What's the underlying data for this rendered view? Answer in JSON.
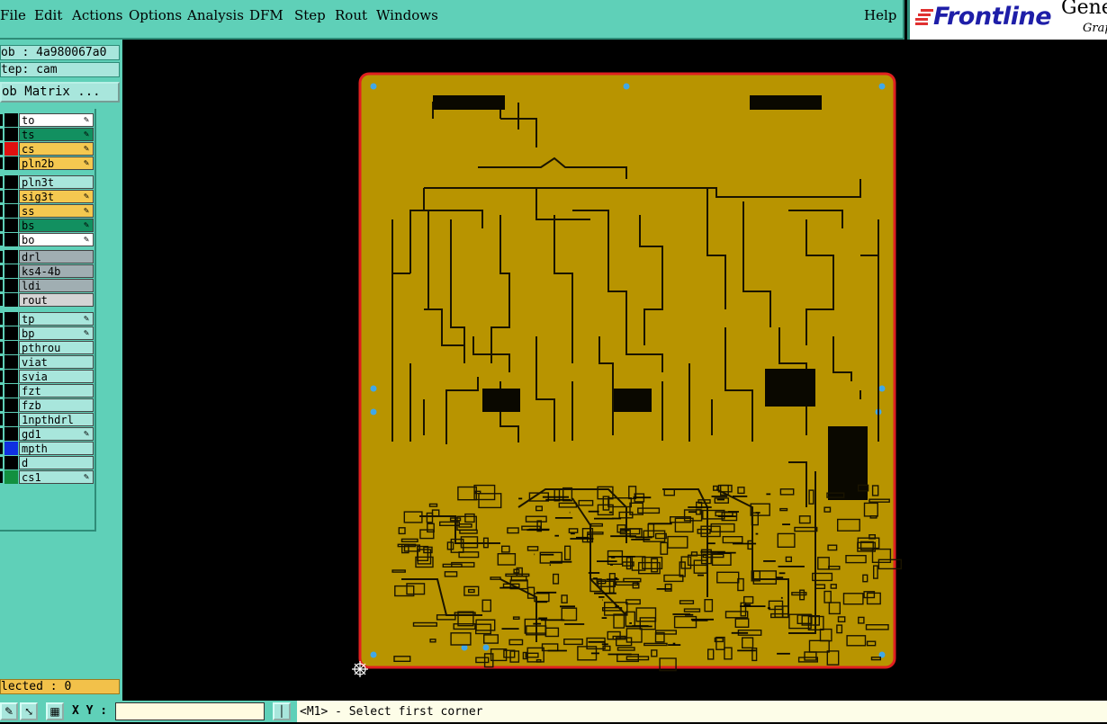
{
  "menu": {
    "file": "File",
    "edit": "Edit",
    "actions": "Actions",
    "options": "Options",
    "analysis": "Analysis",
    "dfm": "DFM",
    "step": "Step",
    "rout": "Rout",
    "windows": "Windows",
    "help": "Help"
  },
  "logo": {
    "brand": "Frontline",
    "product": "Gene",
    "sub": "Grap"
  },
  "panel": {
    "job": "ob : 4a980067a0",
    "step": "tep: cam",
    "matrix_button": "ob Matrix ...",
    "selected": "lected : 0"
  },
  "layers": [
    {
      "name": "to",
      "bg": "#ffffff",
      "swatch": "#000000",
      "pen": true
    },
    {
      "name": "ts",
      "bg": "#129060",
      "swatch": "#000000",
      "pen": true
    },
    {
      "name": "cs",
      "bg": "#f5c850",
      "swatch": "#e01010",
      "pen": true
    },
    {
      "name": "pln2b",
      "bg": "#f5c850",
      "swatch": "#000000",
      "pen": true
    },
    {
      "name": "pln3t",
      "bg": "#a8e6dc",
      "swatch": "#000000",
      "pen": false
    },
    {
      "name": "sig3t",
      "bg": "#f5c850",
      "swatch": "#000000",
      "pen": true
    },
    {
      "name": "ss",
      "bg": "#f5c850",
      "swatch": "#000000",
      "pen": true
    },
    {
      "name": "bs",
      "bg": "#129060",
      "swatch": "#000000",
      "pen": true
    },
    {
      "name": "bo",
      "bg": "#ffffff",
      "swatch": "#000000",
      "pen": true
    },
    {
      "name": "drl",
      "bg": "#a0aeb2",
      "swatch": "#000000",
      "pen": false
    },
    {
      "name": "ks4-4b",
      "bg": "#a0aeb2",
      "swatch": "#000000",
      "pen": false
    },
    {
      "name": "ldi",
      "bg": "#a0aeb2",
      "swatch": "#000000",
      "pen": false
    },
    {
      "name": "rout",
      "bg": "#d4d4d4",
      "swatch": "#000000",
      "pen": false
    },
    {
      "name": "tp",
      "bg": "#a8e6dc",
      "swatch": "#000000",
      "pen": true
    },
    {
      "name": "bp",
      "bg": "#a8e6dc",
      "swatch": "#000000",
      "pen": true
    },
    {
      "name": "pthrou",
      "bg": "#a8e6dc",
      "swatch": "#000000",
      "pen": false
    },
    {
      "name": "viat",
      "bg": "#a8e6dc",
      "swatch": "#000000",
      "pen": false
    },
    {
      "name": "svia",
      "bg": "#a8e6dc",
      "swatch": "#000000",
      "pen": false
    },
    {
      "name": "fzt",
      "bg": "#a8e6dc",
      "swatch": "#000000",
      "pen": false
    },
    {
      "name": "fzb",
      "bg": "#a8e6dc",
      "swatch": "#000000",
      "pen": false
    },
    {
      "name": "1npthdrl",
      "bg": "#a8e6dc",
      "swatch": "#000000",
      "pen": false
    },
    {
      "name": "gd1",
      "bg": "#a8e6dc",
      "swatch": "#000000",
      "pen": true
    },
    {
      "name": "mpth",
      "bg": "#a8e6dc",
      "swatch": "#1030e0",
      "pen": false
    },
    {
      "name": "d",
      "bg": "#a8e6dc",
      "swatch": "#000000",
      "pen": false
    },
    {
      "name": "cs1",
      "bg": "#a8e6dc",
      "swatch": "#129040",
      "pen": true
    }
  ],
  "statusbar": {
    "xy_label": "X Y :",
    "xy_value": "",
    "prompt": "<M1> - Select first corner"
  },
  "colors": {
    "board": "#b89400",
    "outline": "#e02020",
    "trace": "#1a1400",
    "panel": "#5fd0b8"
  },
  "icons": [
    "pen-icon",
    "zoom-icon",
    "grid-icon",
    "pan-icon",
    "cursor-target-icon"
  ]
}
